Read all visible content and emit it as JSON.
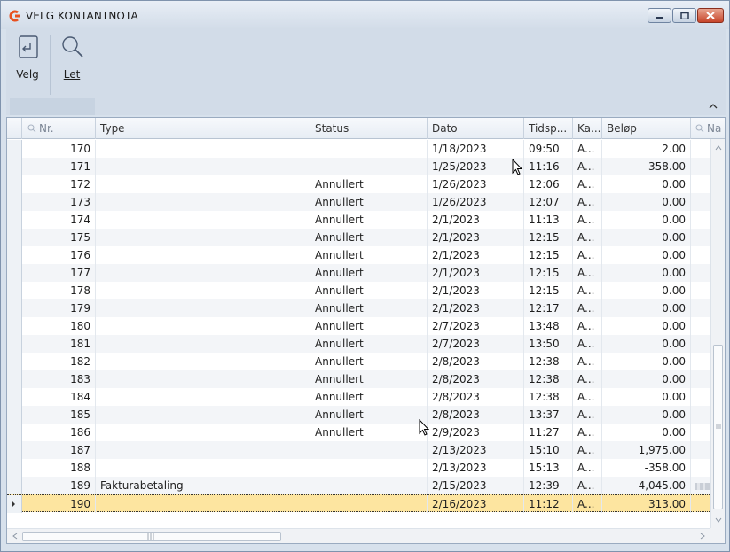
{
  "window": {
    "title": "VELG KONTANTNOTA",
    "accent": "#e8501f"
  },
  "ribbon": {
    "velg_label": "Velg",
    "let_label": "Let"
  },
  "columns": {
    "nr": "Nr.",
    "type": "Type",
    "status": "Status",
    "dato": "Dato",
    "tid": "Tidsp...",
    "ka": "Ka...",
    "belop": "Beløp",
    "na": "Na"
  },
  "rows": [
    {
      "nr": "170",
      "type": "",
      "status": "",
      "dato": "1/18/2023",
      "tid": "09:50",
      "ka": "A...",
      "belop": "2.00"
    },
    {
      "nr": "171",
      "type": "",
      "status": "",
      "dato": "1/25/2023",
      "tid": "11:16",
      "ka": "A...",
      "belop": "358.00"
    },
    {
      "nr": "172",
      "type": "",
      "status": "Annullert",
      "dato": "1/26/2023",
      "tid": "12:06",
      "ka": "A...",
      "belop": "0.00"
    },
    {
      "nr": "173",
      "type": "",
      "status": "Annullert",
      "dato": "1/26/2023",
      "tid": "12:07",
      "ka": "A...",
      "belop": "0.00"
    },
    {
      "nr": "174",
      "type": "",
      "status": "Annullert",
      "dato": "2/1/2023",
      "tid": "11:13",
      "ka": "A...",
      "belop": "0.00"
    },
    {
      "nr": "175",
      "type": "",
      "status": "Annullert",
      "dato": "2/1/2023",
      "tid": "12:15",
      "ka": "A...",
      "belop": "0.00"
    },
    {
      "nr": "176",
      "type": "",
      "status": "Annullert",
      "dato": "2/1/2023",
      "tid": "12:15",
      "ka": "A...",
      "belop": "0.00"
    },
    {
      "nr": "177",
      "type": "",
      "status": "Annullert",
      "dato": "2/1/2023",
      "tid": "12:15",
      "ka": "A...",
      "belop": "0.00"
    },
    {
      "nr": "178",
      "type": "",
      "status": "Annullert",
      "dato": "2/1/2023",
      "tid": "12:15",
      "ka": "A...",
      "belop": "0.00"
    },
    {
      "nr": "179",
      "type": "",
      "status": "Annullert",
      "dato": "2/1/2023",
      "tid": "12:17",
      "ka": "A...",
      "belop": "0.00"
    },
    {
      "nr": "180",
      "type": "",
      "status": "Annullert",
      "dato": "2/7/2023",
      "tid": "13:48",
      "ka": "A...",
      "belop": "0.00"
    },
    {
      "nr": "181",
      "type": "",
      "status": "Annullert",
      "dato": "2/7/2023",
      "tid": "13:50",
      "ka": "A...",
      "belop": "0.00"
    },
    {
      "nr": "182",
      "type": "",
      "status": "Annullert",
      "dato": "2/8/2023",
      "tid": "12:38",
      "ka": "A...",
      "belop": "0.00"
    },
    {
      "nr": "183",
      "type": "",
      "status": "Annullert",
      "dato": "2/8/2023",
      "tid": "12:38",
      "ka": "A...",
      "belop": "0.00"
    },
    {
      "nr": "184",
      "type": "",
      "status": "Annullert",
      "dato": "2/8/2023",
      "tid": "12:38",
      "ka": "A...",
      "belop": "0.00"
    },
    {
      "nr": "185",
      "type": "",
      "status": "Annullert",
      "dato": "2/8/2023",
      "tid": "13:37",
      "ka": "A...",
      "belop": "0.00"
    },
    {
      "nr": "186",
      "type": "",
      "status": "Annullert",
      "dato": "2/9/2023",
      "tid": "11:27",
      "ka": "A...",
      "belop": "0.00"
    },
    {
      "nr": "187",
      "type": "",
      "status": "",
      "dato": "2/13/2023",
      "tid": "15:10",
      "ka": "A...",
      "belop": "1,975.00"
    },
    {
      "nr": "188",
      "type": "",
      "status": "",
      "dato": "2/13/2023",
      "tid": "15:13",
      "ka": "A...",
      "belop": "-358.00"
    },
    {
      "nr": "189",
      "type": "Fakturabetaling",
      "status": "",
      "dato": "2/15/2023",
      "tid": "12:39",
      "ka": "A...",
      "belop": "4,045.00"
    },
    {
      "nr": "190",
      "type": "",
      "status": "",
      "dato": "2/16/2023",
      "tid": "11:12",
      "ka": "A...",
      "belop": "313.00"
    }
  ],
  "selected_row": "190",
  "colors": {
    "selected_row": "#fde5a0",
    "frame": "#d7e1ec"
  }
}
